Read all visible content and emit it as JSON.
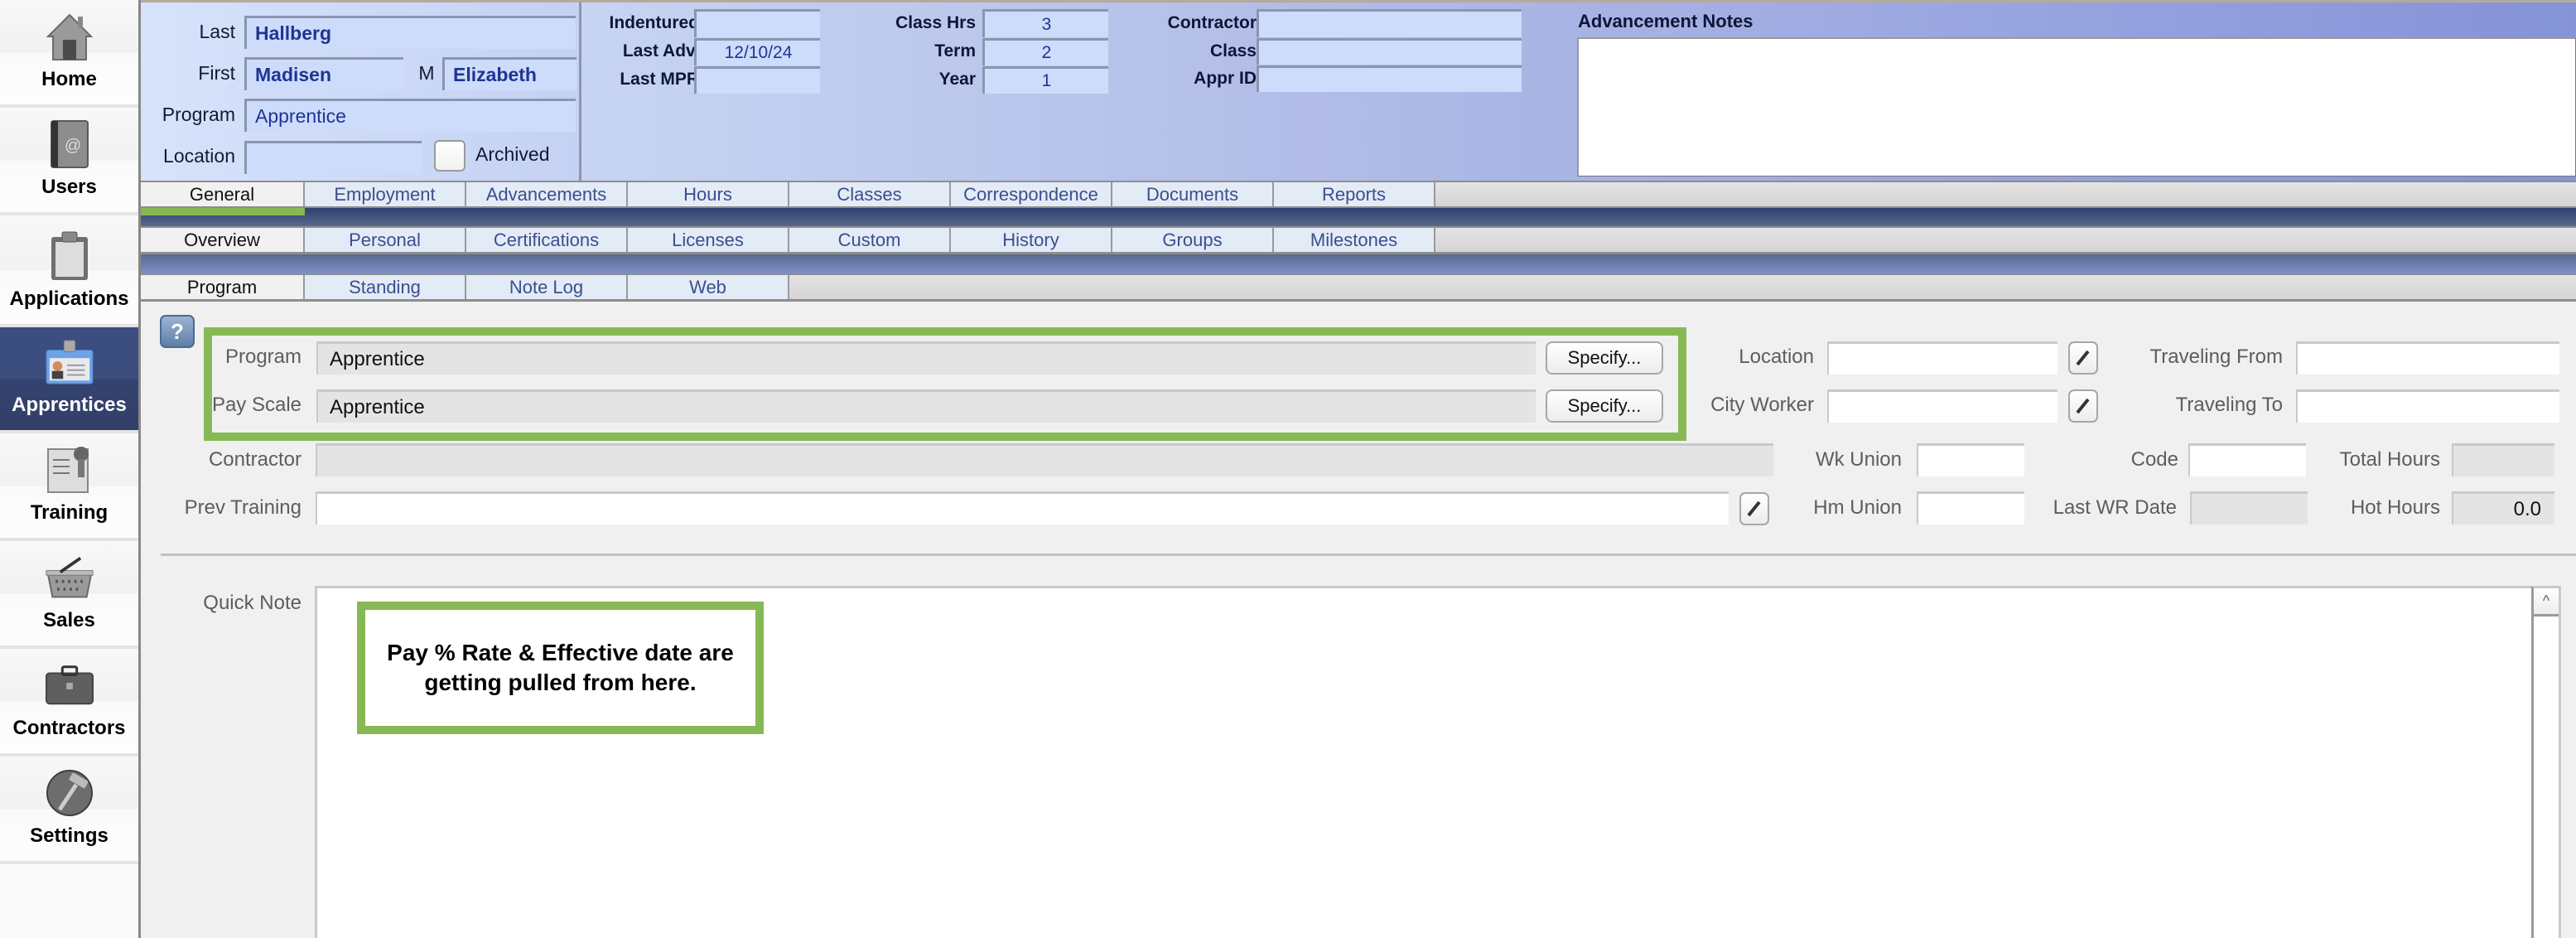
{
  "sidebar": {
    "items": [
      {
        "label": "Home",
        "icon": "house-icon",
        "active": false
      },
      {
        "label": "Users",
        "icon": "address-book-icon",
        "active": false
      },
      {
        "label": "Applications",
        "icon": "clipboard-icon",
        "active": false
      },
      {
        "label": "Apprentices",
        "icon": "id-badge-icon",
        "active": true
      },
      {
        "label": "Training",
        "icon": "certificate-icon",
        "active": false
      },
      {
        "label": "Sales",
        "icon": "basket-icon",
        "active": false
      },
      {
        "label": "Contractors",
        "icon": "briefcase-icon",
        "active": false
      },
      {
        "label": "Settings",
        "icon": "globe-hammer-icon",
        "active": false
      }
    ]
  },
  "header": {
    "name": {
      "last_label": "Last",
      "last_value": "Hallberg",
      "first_label": "First",
      "first_value": "Madisen",
      "middle_label": "M",
      "middle_value": "Elizabeth",
      "program_label": "Program",
      "program_value": "Apprentice",
      "location_label": "Location",
      "location_value": "",
      "archived_label": "Archived",
      "archived_checked": false
    },
    "dates": [
      {
        "label": "Indentured",
        "value": ""
      },
      {
        "label": "Last Adv.",
        "value": "12/10/24"
      },
      {
        "label": "Last MPR",
        "value": ""
      }
    ],
    "hours": [
      {
        "label": "Class Hrs",
        "value": "3"
      },
      {
        "label": "Term",
        "value": "2"
      },
      {
        "label": "Year",
        "value": "1"
      }
    ],
    "contractor": [
      {
        "label": "Contractor",
        "value": ""
      },
      {
        "label": "Class",
        "value": ""
      },
      {
        "label": "Appr ID",
        "value": ""
      }
    ],
    "notes_title": "Advancement Notes",
    "notes_value": ""
  },
  "tabs": {
    "row1": [
      "General",
      "Employment",
      "Advancements",
      "Hours",
      "Classes",
      "Correspondence",
      "Documents",
      "Reports"
    ],
    "row1_active": "General",
    "row2": [
      "Overview",
      "Personal",
      "Certifications",
      "Licenses",
      "Custom",
      "History",
      "Groups",
      "Milestones"
    ],
    "row2_active": "Overview",
    "row3": [
      "Program",
      "Standing",
      "Note Log",
      "Web"
    ],
    "row3_active": "Program"
  },
  "form": {
    "help_label": "?",
    "program_label": "Program",
    "program_value": "Apprentice",
    "payscale_label": "Pay Scale",
    "payscale_value": "Apprentice",
    "specify_label": "Specify...",
    "contractor_label": "Contractor",
    "contractor_value": "",
    "prev_training_label": "Prev Training",
    "prev_training_value": "",
    "location_label": "Location",
    "location_value": "",
    "city_worker_label": "City  Worker",
    "city_worker_value": "",
    "traveling_from_label": "Traveling From",
    "traveling_from_value": "",
    "traveling_to_label": "Traveling To",
    "traveling_to_value": "",
    "wk_union_label": "Wk Union",
    "wk_union_value": "",
    "hm_union_label": "Hm Union",
    "hm_union_value": "",
    "code_label": "Code",
    "code_value": "",
    "last_wr_date_label": "Last WR Date",
    "last_wr_date_value": "",
    "total_hours_label": "Total  Hours",
    "total_hours_value": "",
    "hot_hours_label": "Hot Hours",
    "hot_hours_value": "0.0",
    "quick_note_label": "Quick Note",
    "quick_note_value": ""
  },
  "annotation": {
    "text": "Pay % Rate & Effective date are getting pulled from here.",
    "color": "#86b954"
  }
}
